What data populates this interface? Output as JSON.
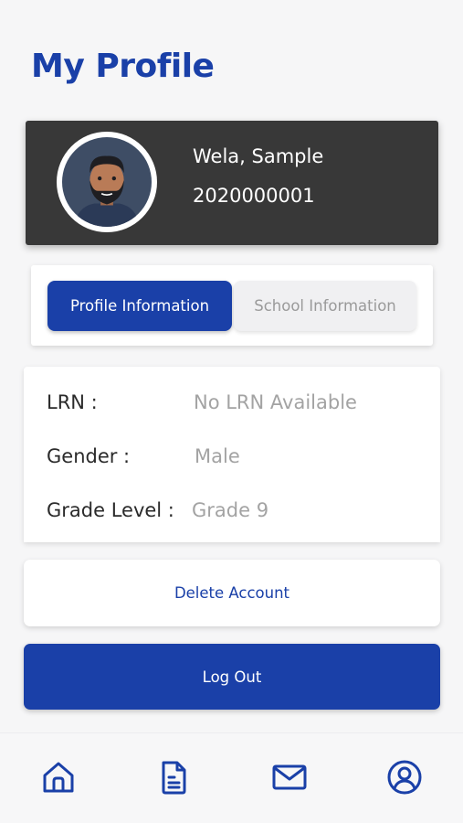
{
  "header": {
    "title": "My Profile"
  },
  "profile": {
    "name": "Wela, Sample",
    "student_id": "2020000001",
    "avatar_icon": "user-avatar-illustration"
  },
  "tabs": [
    {
      "label": "Profile Information",
      "active": true
    },
    {
      "label": "School Information",
      "active": false
    }
  ],
  "info": [
    {
      "label": "LRN :",
      "value": "No LRN Available"
    },
    {
      "label": "Gender :",
      "value": "Male"
    },
    {
      "label": "Grade Level :",
      "value": "Grade 9"
    }
  ],
  "actions": {
    "delete_label": "Delete Account",
    "logout_label": "Log Out"
  },
  "bottom_nav": [
    {
      "icon": "home-icon"
    },
    {
      "icon": "document-icon"
    },
    {
      "icon": "mail-icon"
    },
    {
      "icon": "profile-icon",
      "active": true
    }
  ],
  "colors": {
    "accent": "#1a40a8",
    "card_dark": "#383838",
    "muted_text": "#a3a3a3"
  }
}
